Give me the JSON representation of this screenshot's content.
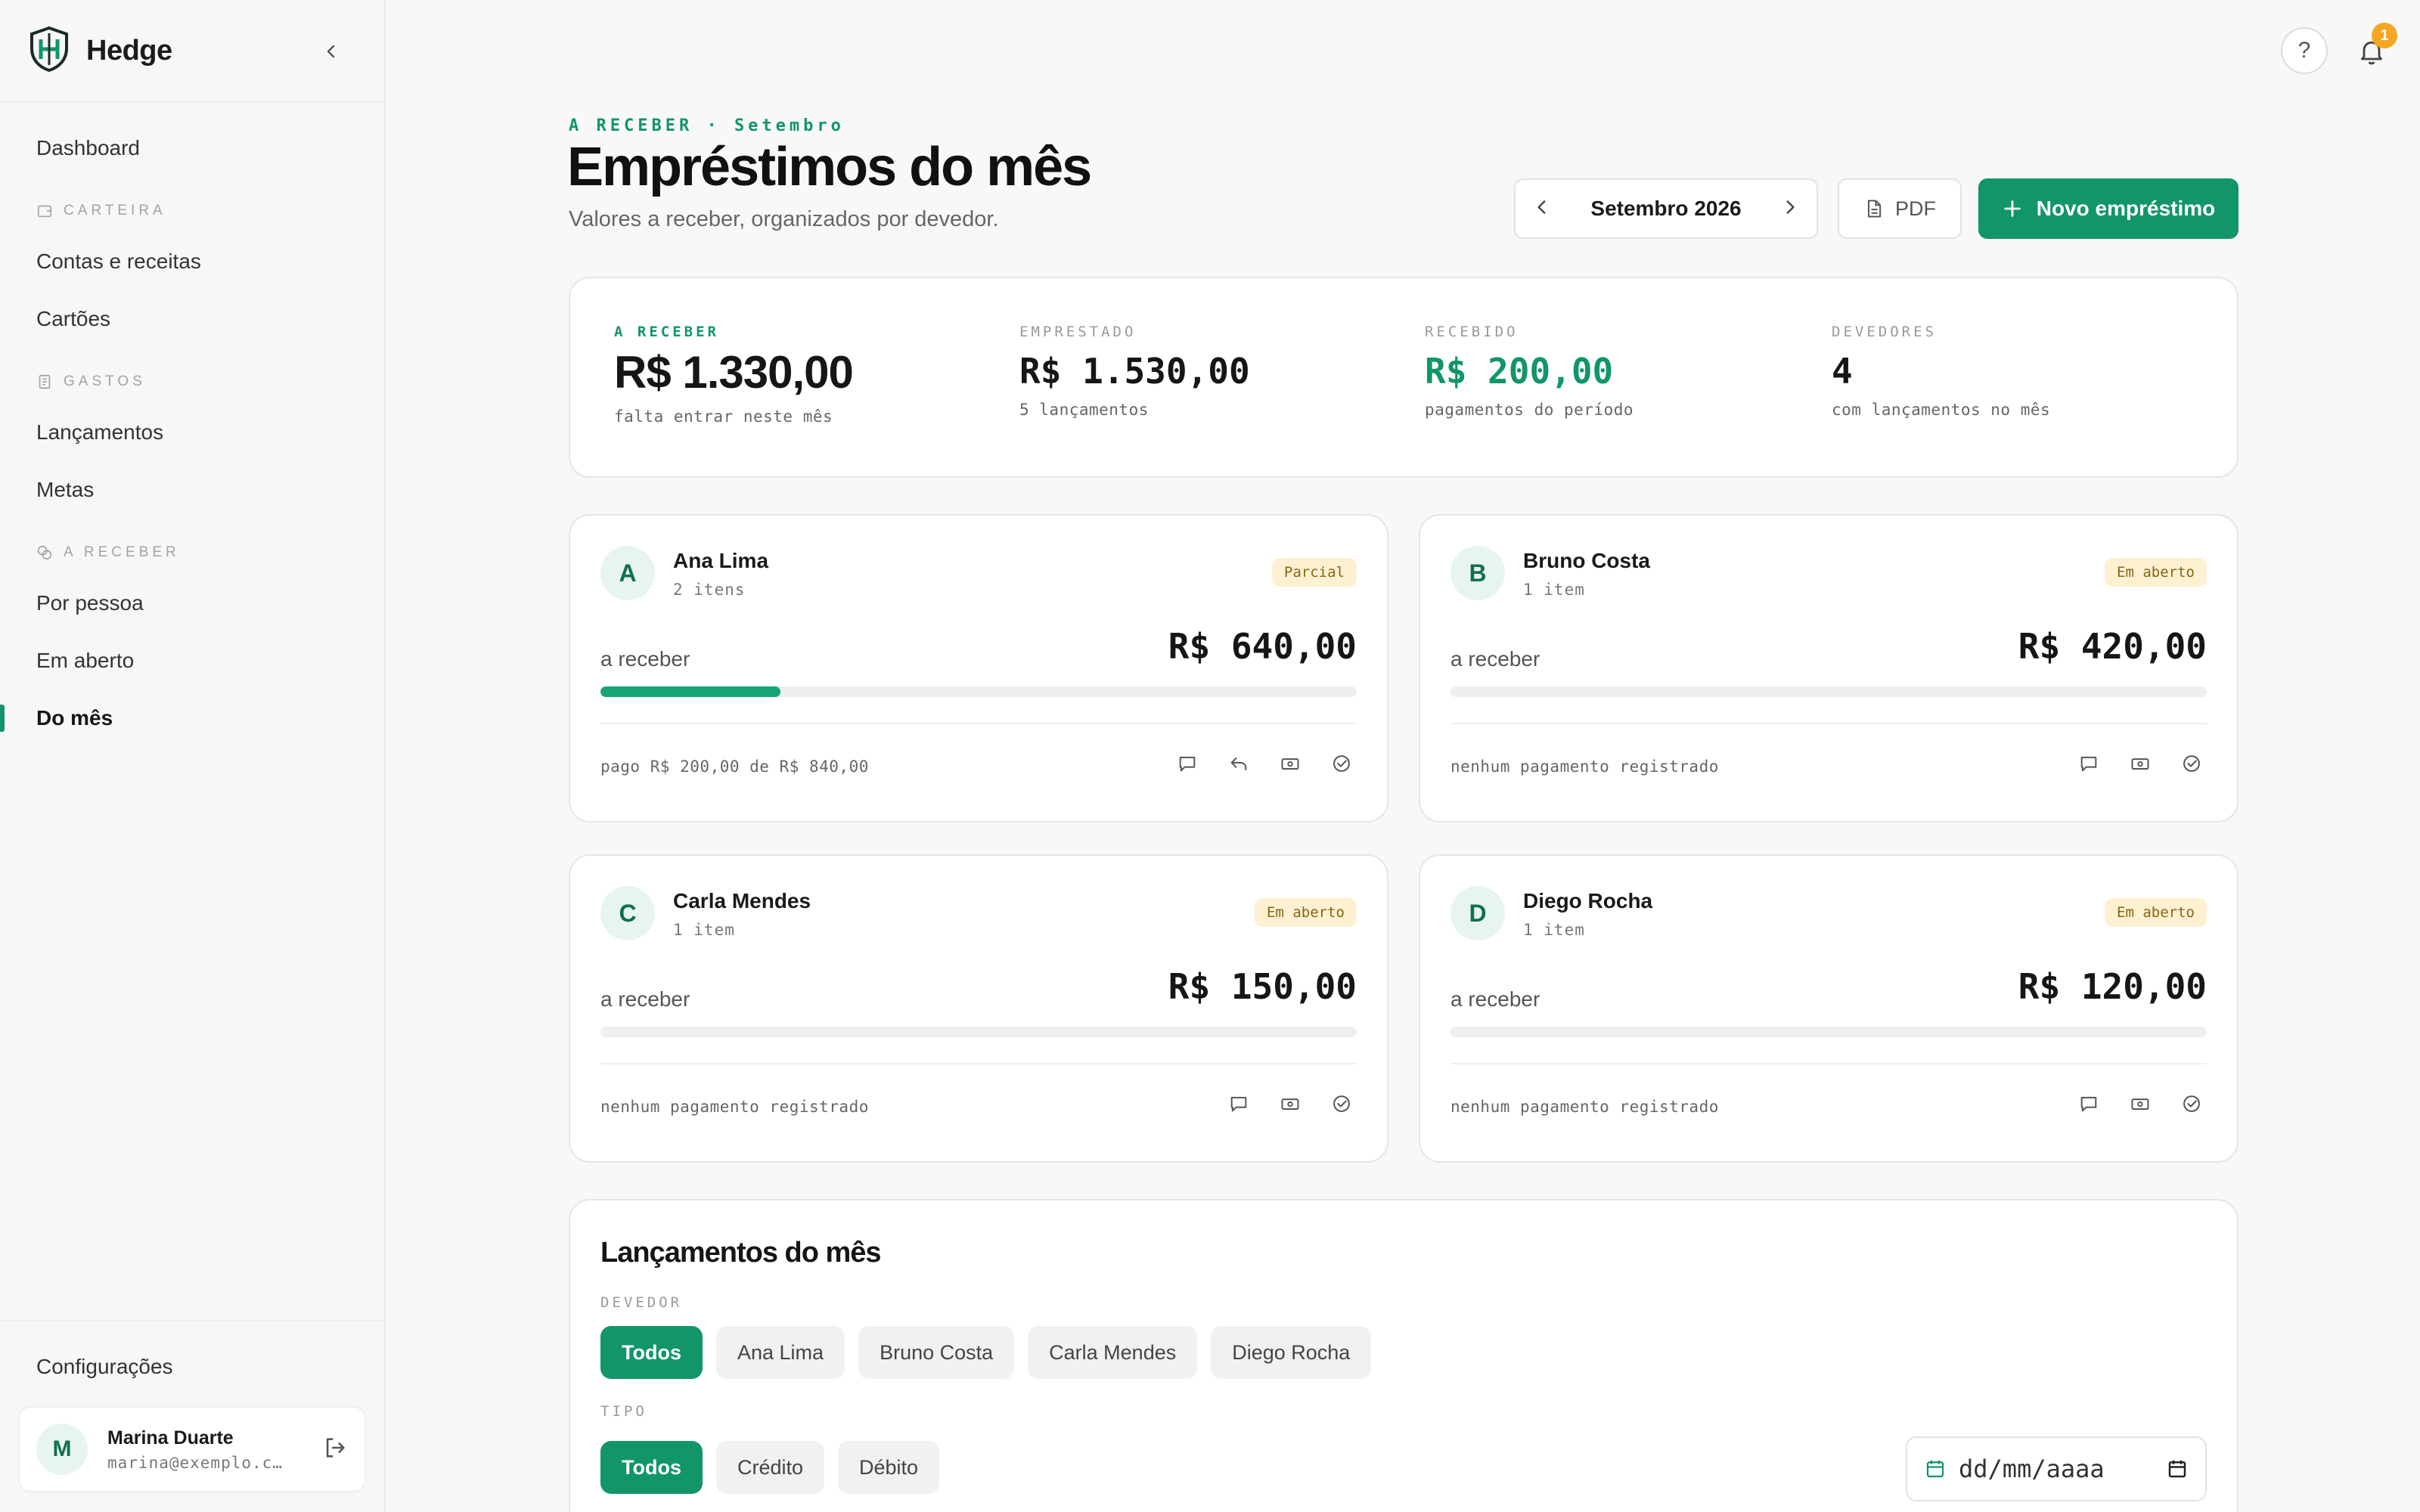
{
  "brand": {
    "name": "Hedge"
  },
  "sidebar": {
    "dashboard": "Dashboard",
    "sections": [
      {
        "label": "CARTEIRA",
        "items": [
          "Contas e receitas",
          "Cartões"
        ]
      },
      {
        "label": "GASTOS",
        "items": [
          "Lançamentos",
          "Metas"
        ]
      },
      {
        "label": "A RECEBER",
        "items": [
          "Por pessoa",
          "Em aberto",
          "Do mês"
        ]
      }
    ],
    "settings": "Configurações",
    "user": {
      "initial": "M",
      "name": "Marina Duarte",
      "email": "marina@exemplo.c…"
    }
  },
  "topbar": {
    "help": "?",
    "notifications_count": "1"
  },
  "header": {
    "eyebrow": "A RECEBER · Setembro",
    "title": "Empréstimos do mês",
    "subtitle": "Valores a receber, organizados por devedor.",
    "month": "Setembro 2026",
    "pdf_label": "PDF",
    "new_label": "Novo empréstimo"
  },
  "summary": [
    {
      "label": "A RECEBER",
      "value": "R$ 1.330,00",
      "sub": "falta entrar neste mês"
    },
    {
      "label": "EMPRESTADO",
      "value": "R$ 1.530,00",
      "sub": "5 lançamentos"
    },
    {
      "label": "RECEBIDO",
      "value": "R$ 200,00",
      "sub": "pagamentos do período"
    },
    {
      "label": "DEVEDORES",
      "value": "4",
      "sub": "com lançamentos no mês"
    }
  ],
  "debtors": [
    {
      "initial": "A",
      "name": "Ana Lima",
      "items": "2 itens",
      "status": "Parcial",
      "receive_label": "a receber",
      "amount": "R$ 640,00",
      "progress": 0.238,
      "footer": "pago R$ 200,00 de R$ 840,00"
    },
    {
      "initial": "B",
      "name": "Bruno Costa",
      "items": "1 item",
      "status": "Em aberto",
      "receive_label": "a receber",
      "amount": "R$ 420,00",
      "progress": 0,
      "footer": "nenhum pagamento registrado"
    },
    {
      "initial": "C",
      "name": "Carla Mendes",
      "items": "1 item",
      "status": "Em aberto",
      "receive_label": "a receber",
      "amount": "R$ 150,00",
      "progress": 0,
      "footer": "nenhum pagamento registrado"
    },
    {
      "initial": "D",
      "name": "Diego Rocha",
      "items": "1 item",
      "status": "Em aberto",
      "receive_label": "a receber",
      "amount": "R$ 120,00",
      "progress": 0,
      "footer": "nenhum pagamento registrado"
    }
  ],
  "entries": {
    "title": "Lançamentos do mês",
    "debtor_filter_label": "DEVEDOR",
    "debtor_filters": [
      "Todos",
      "Ana Lima",
      "Bruno Costa",
      "Carla Mendes",
      "Diego Rocha"
    ],
    "type_filter_label": "TIPO",
    "type_filters": [
      "Todos",
      "Crédito",
      "Débito"
    ],
    "date_placeholder": "dd/mm/aaaa"
  },
  "colors": {
    "accent": "#12956b",
    "badge_bg": "#fdf1d2",
    "badge_text": "#8a6412",
    "notification": "#f5a623"
  }
}
